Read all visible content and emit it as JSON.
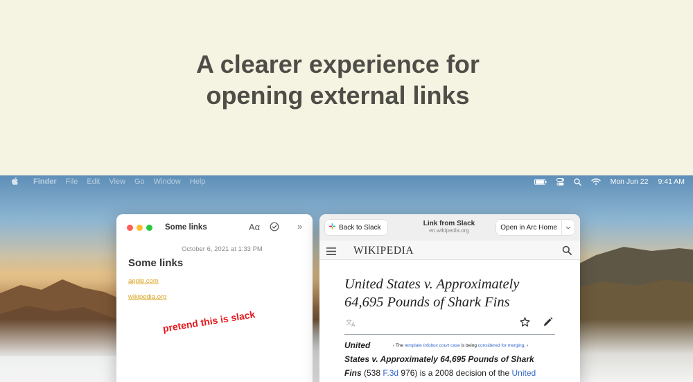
{
  "hero": {
    "line1": "A clearer experience for",
    "line2": "opening external links"
  },
  "menubar": {
    "app": "Finder",
    "items": [
      "File",
      "Edit",
      "View",
      "Go",
      "Window",
      "Help"
    ],
    "date": "Mon Jun 22",
    "time": "9:41 AM",
    "icons": [
      "apple-icon",
      "battery-icon",
      "control-center-icon",
      "search-icon",
      "wifi-icon"
    ]
  },
  "notes": {
    "title": "Some links",
    "format_label": "Aα",
    "more_label": "»",
    "timestamp": "October 6, 2021 at 1:33 PM",
    "heading": "Some links",
    "links": [
      "apple.com",
      "wikipedia.org"
    ],
    "annotation": "pretend this is slack"
  },
  "arc": {
    "back_label": "Back to Slack",
    "source_title": "Link from Slack",
    "source_url": "en.wikipedia.org",
    "open_label": "Open in Arc Home",
    "wiki_logo": "WIKIPEDIA",
    "article_title": "United States v. Approximately 64,695 Pounds of Shark Fins",
    "body_bold_1": "United",
    "notice_pre": "‹ The ",
    "notice_link1": "template",
    "notice_italic": " Infobox court case",
    "notice_mid": " is being ",
    "notice_link2": "considered for merging",
    "notice_post": ". ›",
    "body_bold_2": "States v. Approximately 64,695 Pounds of Shark",
    "body_line3_bold": "Fins",
    "body_line3_a": " (538 ",
    "body_line3_link": "F.3d",
    "body_line3_b": " 976) is a 2008 decision of the ",
    "body_line3_link2": "United"
  },
  "colors": {
    "hero_bg": "#f5f3e1",
    "hero_text": "#4e4d47",
    "link_yellow": "#d9a21c",
    "annotation_red": "#e6191d",
    "wiki_link": "#3366cc"
  }
}
